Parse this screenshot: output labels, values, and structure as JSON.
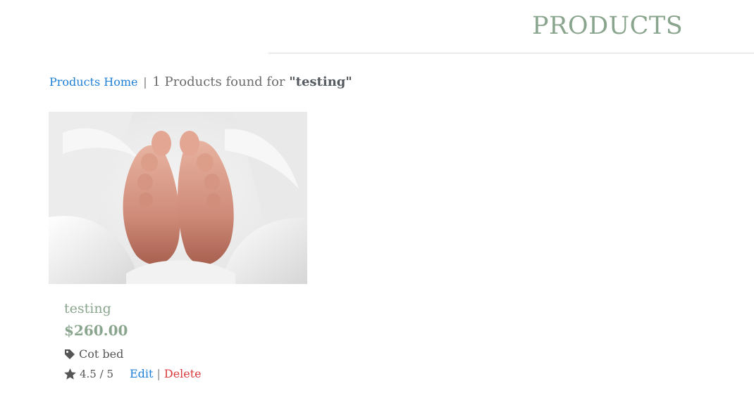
{
  "header": {
    "title": "PRODUCTS"
  },
  "breadcrumb": {
    "home_link": "Products Home",
    "separator": "|",
    "result_text": "1 Products found for",
    "query": "\"testing\""
  },
  "products": [
    {
      "name": "testing",
      "price": "$260.00",
      "category": "Cot bed",
      "rating": "4.5 / 5",
      "edit_label": "Edit",
      "action_separator": "|",
      "delete_label": "Delete",
      "image_icon": "baby-feet-photo"
    }
  ],
  "colors": {
    "accent_sage": "#8aa58e",
    "link_blue": "#1e7fd6",
    "delete_red": "#d9393d"
  },
  "icons": {
    "category": "tag-icon",
    "rating": "star-icon"
  }
}
